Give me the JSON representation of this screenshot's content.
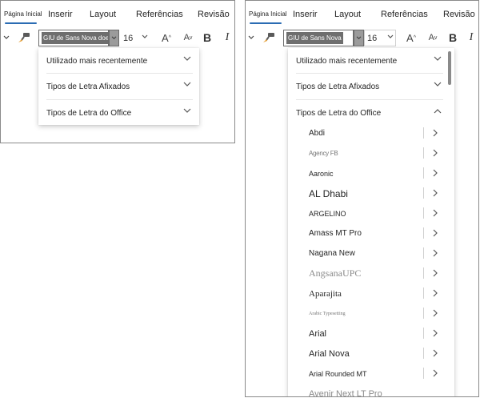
{
  "left": {
    "tabs": [
      "Página Inicial",
      "Inserir",
      "Layout",
      "Referências",
      "Revisão"
    ],
    "font_name": "GIU de Sans Nova doente",
    "font_size": "16",
    "sections": [
      "Utilizado mais recentemente",
      "Tipos de Letra Afixados",
      "Tipos de Letra do Office"
    ]
  },
  "right": {
    "tabs": [
      "Página Inicial",
      "Inserir",
      "Layout",
      "Referências",
      "Revisão"
    ],
    "font_name": "GIU de Sans Nova",
    "font_size": "16",
    "sections": [
      "Utilizado mais recentemente",
      "Tipos de Letra Afixados",
      "Tipos de Letra do Office"
    ],
    "fonts": [
      "Abdi",
      "Agency FB",
      "Aaronic",
      "AL Dhabi",
      "ARGELINO",
      "Amass MT Pro",
      "Nagana New",
      "AngsanaUPC",
      "Aparajita",
      "Arabic Typesetting",
      "Arial",
      "Arial Nova",
      "Arial Rounded MT",
      "Avenir Next LT Pro"
    ]
  },
  "toolbar": {
    "grow_font": "A",
    "shrink_font": "A",
    "bold": "B",
    "italic": "I"
  },
  "colors": {
    "tab_underline": "#2b6cb3",
    "font_name_highlight": "#6e6e6e",
    "panel_border": "#8a8a8a"
  },
  "icons": [
    "chevron-down-icon",
    "format-painter-icon",
    "chevron-right-icon",
    "chevron-up-icon"
  ]
}
